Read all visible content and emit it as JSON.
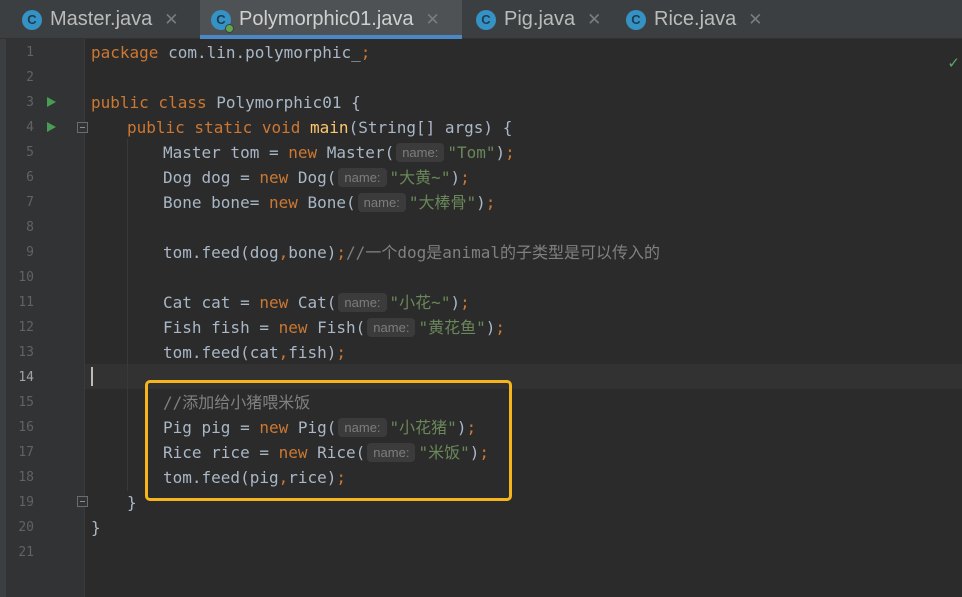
{
  "tabs": [
    {
      "label": "Master.java",
      "active": false,
      "close": "✕"
    },
    {
      "label": "Polymorphic01.java",
      "active": true,
      "close": "✕"
    },
    {
      "label": "Pig.java",
      "active": false,
      "close": "✕"
    },
    {
      "label": "Rice.java",
      "active": false,
      "close": "✕"
    }
  ],
  "class_icon_letter": "C",
  "line_numbers": [
    "1",
    "2",
    "3",
    "4",
    "5",
    "6",
    "7",
    "8",
    "9",
    "10",
    "11",
    "12",
    "13",
    "14",
    "15",
    "16",
    "17",
    "18",
    "19",
    "20",
    "21"
  ],
  "current_line": "14",
  "code": {
    "l1": {
      "kw": "package",
      "rest": " com.lin.polymorphic_",
      "semi": ";"
    },
    "l3": {
      "kw": "public class",
      "rest": " Polymorphic01 {"
    },
    "l4": {
      "kw": "public static void",
      "fn": "main",
      "rest": "(String[] args) {"
    },
    "l5": {
      "pre": "Master tom = ",
      "kw": "new",
      "call": " Master(",
      "hint": "name:",
      "str": "\"Tom\"",
      "end": ")",
      "semi": ";"
    },
    "l6": {
      "pre": "Dog dog = ",
      "kw": "new",
      "call": " Dog(",
      "hint": "name:",
      "str": "\"大黄~\"",
      "end": ")",
      "semi": ";"
    },
    "l7": {
      "pre": "Bone bone= ",
      "kw": "new",
      "call": " Bone(",
      "hint": "name:",
      "str": "\"大棒骨\"",
      "end": ")",
      "semi": ";"
    },
    "l9": {
      "pre": "tom.feed(dog",
      "comma": ",",
      "mid": "bone)",
      "semi": ";",
      "comment": "//一个dog是animal的子类型是可以传入的"
    },
    "l11": {
      "pre": "Cat cat = ",
      "kw": "new",
      "call": " Cat(",
      "hint": "name:",
      "str": "\"小花~\"",
      "end": ")",
      "semi": ";"
    },
    "l12": {
      "pre": "Fish fish = ",
      "kw": "new",
      "call": " Fish(",
      "hint": "name:",
      "str": "\"黄花鱼\"",
      "end": ")",
      "semi": ";"
    },
    "l13": {
      "pre": "tom.feed(cat",
      "comma": ",",
      "mid": "fish)",
      "semi": ";"
    },
    "l15": {
      "comment": "//添加给小猪喂米饭"
    },
    "l16": {
      "pre": "Pig pig = ",
      "kw": "new",
      "call": " Pig(",
      "hint": "name:",
      "str": "\"小花猪\"",
      "end": ")",
      "semi": ";"
    },
    "l17": {
      "pre": "Rice rice = ",
      "kw": "new",
      "call": " Rice(",
      "hint": "name:",
      "str": "\"米饭\"",
      "end": ")",
      "semi": ";"
    },
    "l18": {
      "pre": "tom.feed(pig",
      "comma": ",",
      "mid": "rice)",
      "semi": ";"
    },
    "l19": {
      "text": "}"
    },
    "l20": {
      "text": "}"
    }
  },
  "inspection_status": "✓",
  "colors": {
    "highlight_box": "#f6b51d",
    "keyword": "#cc7832",
    "string": "#6a8759",
    "comment": "#808080",
    "function": "#ffc66d"
  }
}
